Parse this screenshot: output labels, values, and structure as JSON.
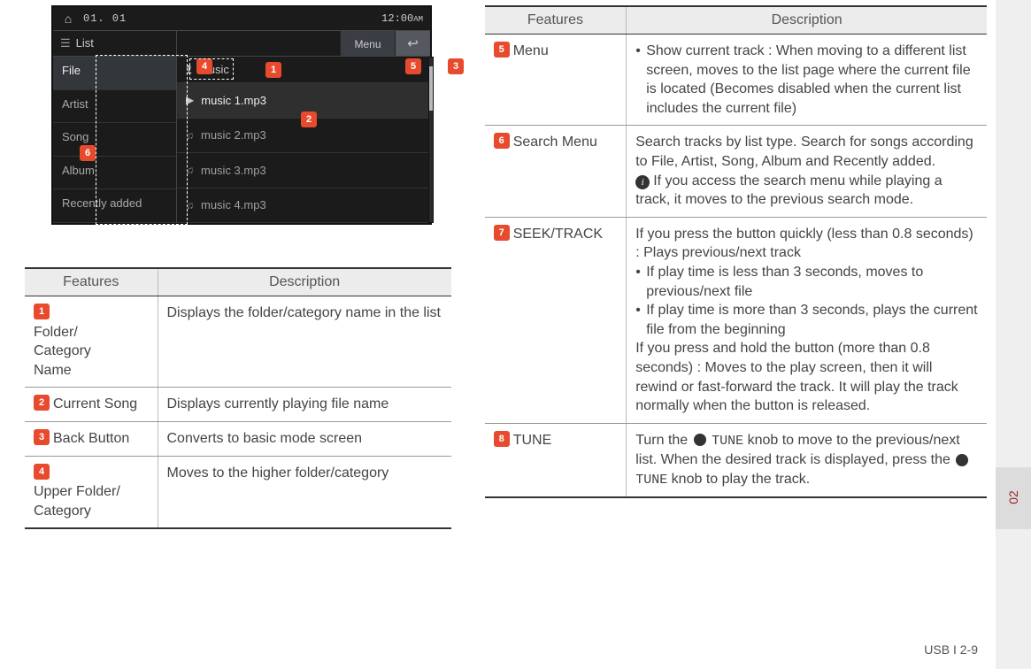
{
  "device": {
    "status": {
      "date": "01. 01",
      "time": "12:00",
      "ampm": "AM"
    },
    "header": {
      "list_label": "List",
      "menu_label": "Menu"
    },
    "crumb": {
      "root_label": "Music"
    },
    "side_items": [
      "File",
      "Artist",
      "Song",
      "Album",
      "Recently added"
    ],
    "tracks": [
      "music 1.mp3",
      "music 2.mp3",
      "music 3.mp3",
      "music 4.mp3"
    ]
  },
  "callouts": {
    "c1": "1",
    "c2": "2",
    "c3": "3",
    "c4": "4",
    "c5": "5",
    "c6": "6"
  },
  "left_table": {
    "headers": {
      "features": "Features",
      "description": "Description"
    },
    "rows": [
      {
        "n": "1",
        "name": "Folder/ Category Name",
        "desc": "Displays the folder/category name in the list"
      },
      {
        "n": "2",
        "name": "Current Song",
        "desc": "Displays currently playing file name"
      },
      {
        "n": "3",
        "name": "Back Button",
        "desc": "Converts to basic mode screen"
      },
      {
        "n": "4",
        "name": "Upper Folder/ Category",
        "desc": "Moves to the higher folder/category"
      }
    ]
  },
  "right_table": {
    "headers": {
      "features": "Features",
      "description": "Description"
    },
    "rows": [
      {
        "n": "5",
        "name": "Menu",
        "desc_bullet": "Show current track :  When moving to a different list screen, moves to the list page where the current file is located (Becomes disabled when the current list includes the current file)"
      },
      {
        "n": "6",
        "name": "Search Menu",
        "desc_plain": "Search tracks by list type. Search for songs according to File, Artist, Song, Album and Recently added.",
        "desc_info": "If you access the search menu while playing a track, it moves to the previous search mode."
      },
      {
        "n": "7",
        "name": "SEEK/TRACK",
        "desc_parts": {
          "p1": "If you press the button quickly (less than 0.8 seconds) : Plays previous/next track",
          "b1": "If play time is less than 3 seconds, moves to previous/next file",
          "b2": "If play time is more than 3 seconds, plays the current file from the beginning",
          "p2": "If you press and hold the button (more than 0.8 seconds) : Moves to the play screen, then it will rewind or fast-forward the track. It will play the track normally when the button is released."
        }
      },
      {
        "n": "8",
        "name": "TUNE",
        "tune": {
          "pre1": "Turn the ",
          "knob_label": "TUNE",
          "mid": " knob to move to the previous/next list. When the desired track is displayed, press the ",
          "post": " knob to play the track."
        }
      }
    ]
  },
  "sidetab": {
    "section_number": "02"
  },
  "footer": {
    "text": "USB I 2-9"
  }
}
